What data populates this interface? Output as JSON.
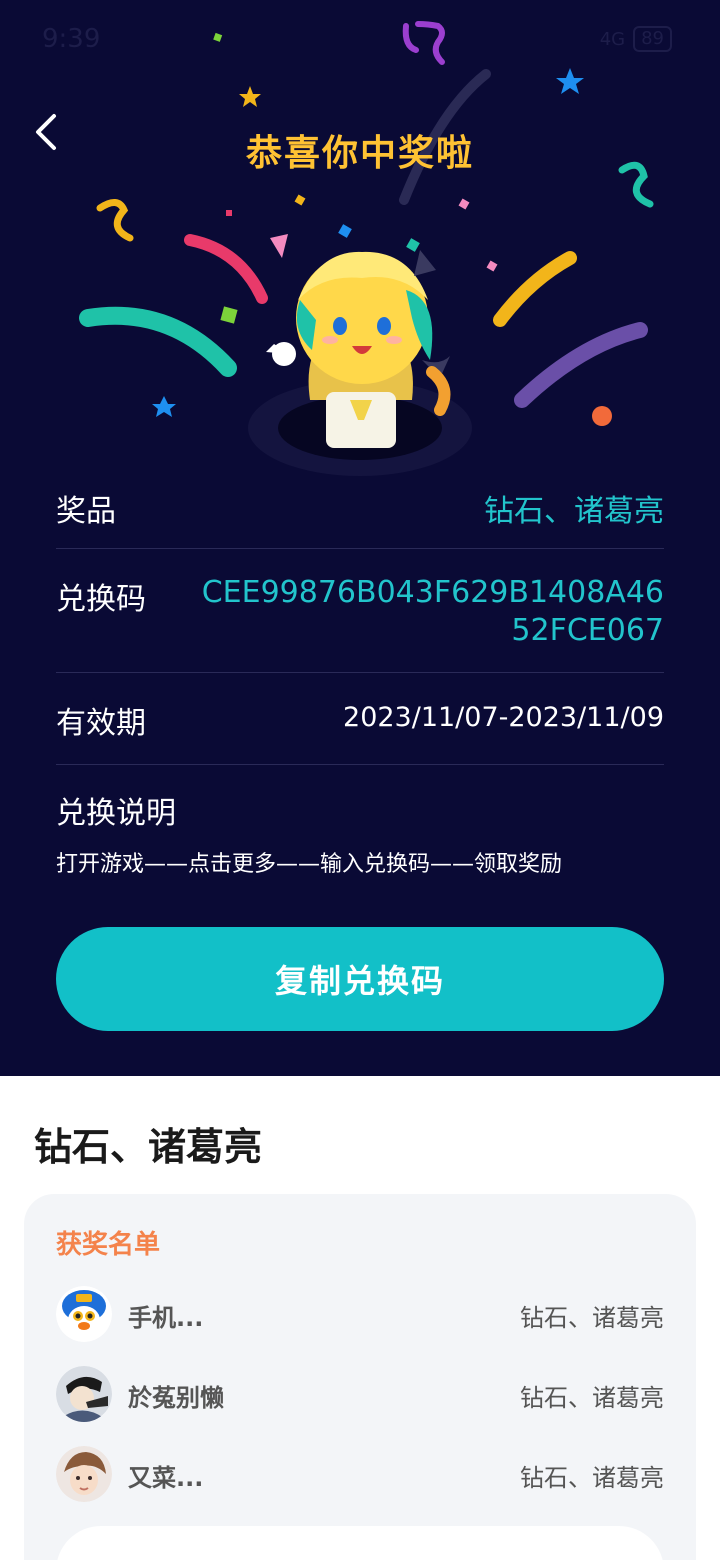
{
  "status_bar": {
    "time": "9:39",
    "network": "4G",
    "battery": "89"
  },
  "header": {
    "title": "恭喜你中奖啦"
  },
  "details": {
    "prize_label": "奖品",
    "prize_value": "钻石、诸葛亮",
    "code_label": "兑换码",
    "code_value": "CEE99876B043F629B1408A4652FCE067",
    "validity_label": "有效期",
    "validity_value": "2023/11/07-2023/11/09",
    "instructions_label": "兑换说明",
    "instructions_text": "打开游戏——点击更多——输入兑换码——领取奖励"
  },
  "copy_button_label": "复制兑换码",
  "section_title": "钻石、诸葛亮",
  "winners": {
    "title": "获奖名单",
    "list": [
      {
        "name": "手机...",
        "prize": "钻石、诸葛亮"
      },
      {
        "name": "於菟别懒",
        "prize": "钻石、诸葛亮"
      },
      {
        "name": "又菜...",
        "prize": "钻石、诸葛亮"
      }
    ]
  },
  "colors": {
    "background": "#0a0a35",
    "accent": "#12c0c8",
    "title": "#ffc233",
    "winners_title": "#f4834b"
  }
}
